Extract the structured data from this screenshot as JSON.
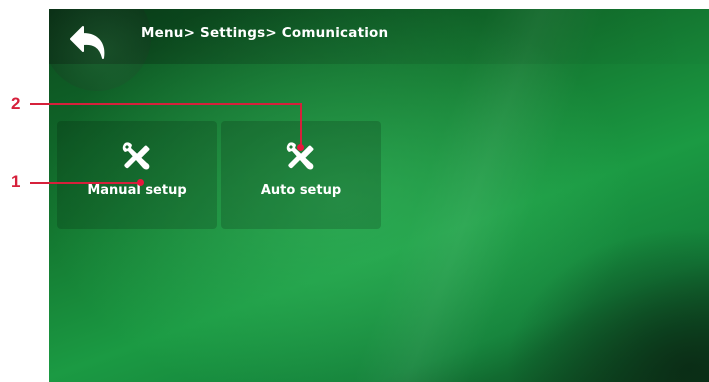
{
  "header": {
    "breadcrumb": "Menu> Settings> Comunication",
    "back_icon": "back-arrow-icon"
  },
  "tiles": [
    {
      "label": "Manual setup",
      "icon": "tools-icon"
    },
    {
      "label": "Auto setup",
      "icon": "tools-icon"
    }
  ],
  "callouts": [
    {
      "number": "1"
    },
    {
      "number": "2"
    }
  ],
  "colors": {
    "callout": "#d6203b",
    "background": "#1b9a43",
    "text": "#ffffff"
  }
}
